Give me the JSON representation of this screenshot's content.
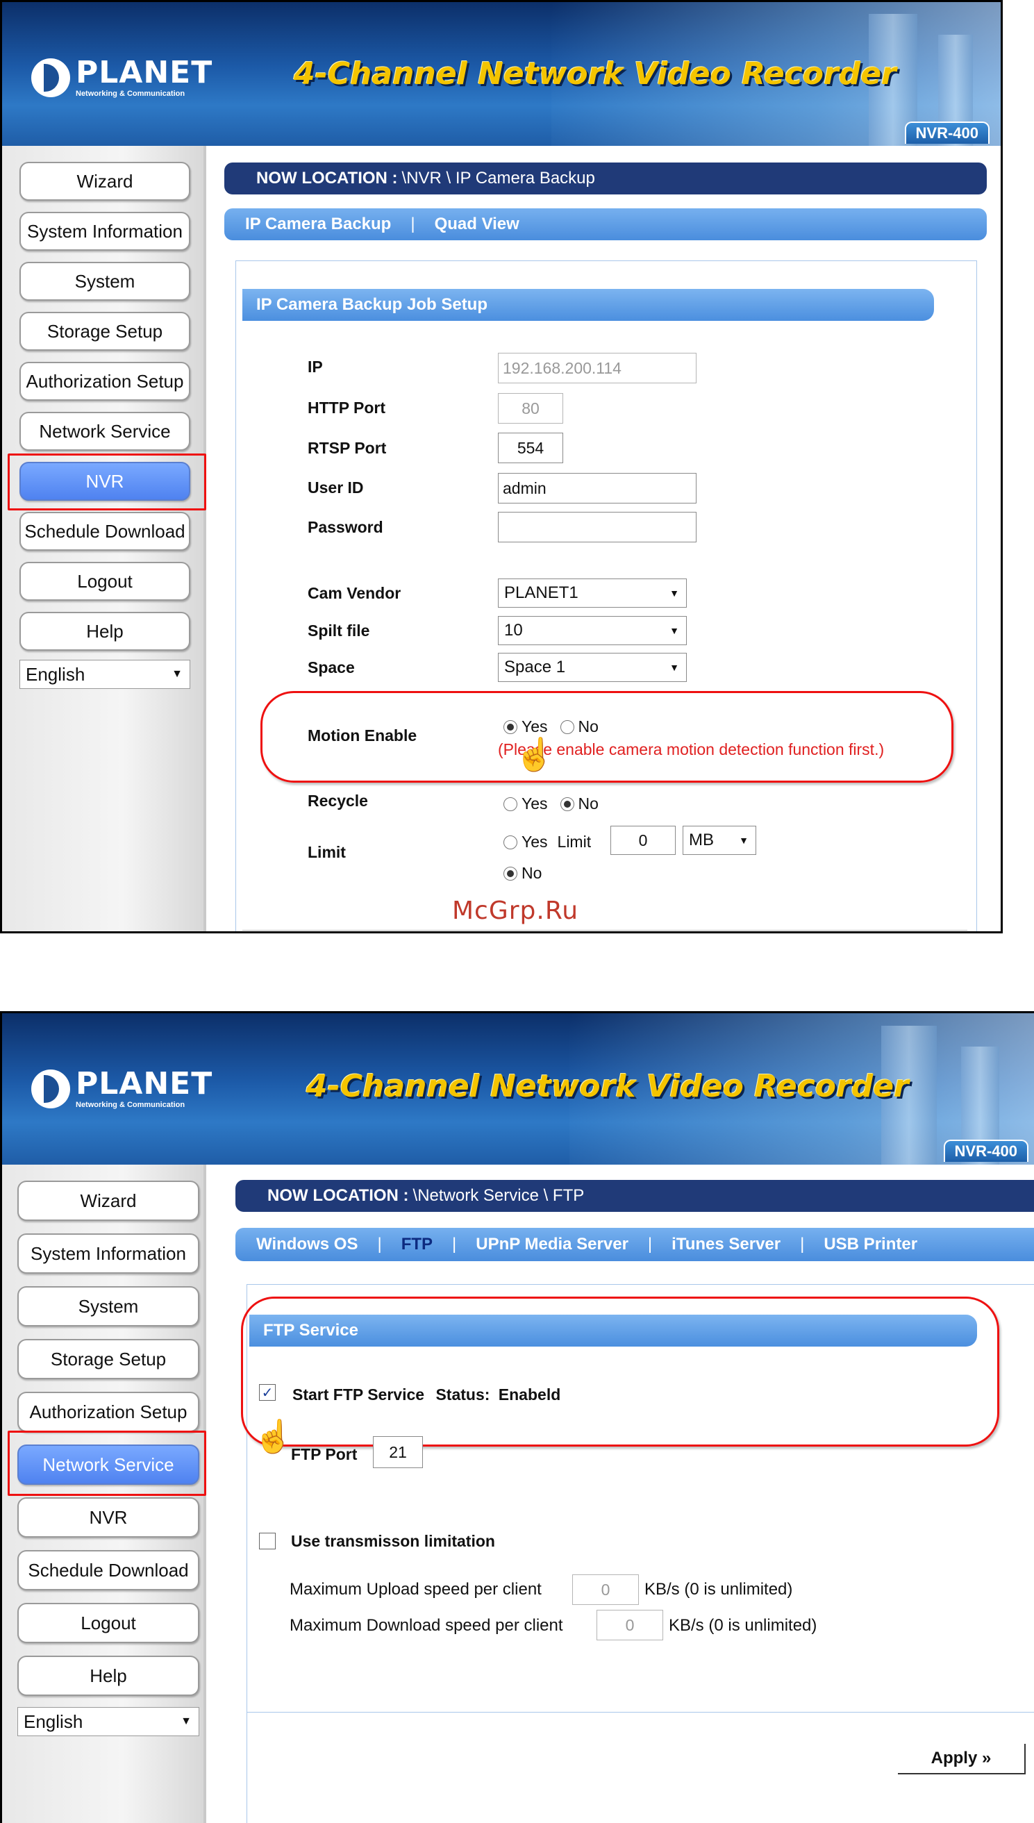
{
  "watermark": "McGrp.Ru",
  "header": {
    "logo_name": "PLANET",
    "logo_sub": "Networking & Communication",
    "title": "4-Channel Network Video Recorder",
    "model": "NVR-400"
  },
  "panel1": {
    "nav": [
      "Wizard",
      "System Information",
      "System",
      "Storage Setup",
      "Authorization Setup",
      "Network Service",
      "NVR",
      "Schedule Download",
      "Logout",
      "Help"
    ],
    "language": "English",
    "location_label": "NOW LOCATION :",
    "location_path": "\\NVR \\ IP Camera Backup",
    "tabs": [
      "IP Camera Backup",
      "Quad View"
    ],
    "tab_separator": "|",
    "section_title": "IP Camera Backup Job Setup",
    "fields": {
      "ip_label": "IP",
      "ip_value": "192.168.200.114",
      "http_label": "HTTP Port",
      "http_value": "80",
      "rtsp_label": "RTSP Port",
      "rtsp_value": "554",
      "user_label": "User ID",
      "user_value": "admin",
      "password_label": "Password",
      "password_value": "",
      "vendor_label": "Cam Vendor",
      "vendor_value": "PLANET1",
      "split_label": "Spilt file",
      "split_value": "10",
      "space_label": "Space",
      "space_value": "Space 1",
      "motion_label": "Motion Enable",
      "motion_note": "(Please enable camera motion detection function first.)",
      "recycle_label": "Recycle",
      "limit_label": "Limit",
      "limit_inline": "Limit",
      "limit_value": "0",
      "limit_unit": "MB",
      "yes": "Yes",
      "no": "No"
    }
  },
  "panel2": {
    "nav": [
      "Wizard",
      "System Information",
      "System",
      "Storage Setup",
      "Authorization Setup",
      "Network Service",
      "NVR",
      "Schedule Download",
      "Logout",
      "Help"
    ],
    "language": "English",
    "location_label": "NOW LOCATION :",
    "location_path": "\\Network Service \\ FTP",
    "tabs": [
      "Windows OS",
      "FTP",
      "UPnP Media Server",
      "iTunes Server",
      "USB Printer"
    ],
    "tab_separator": "|",
    "section_title": "FTP Service",
    "start_ftp_label": "Start FTP Service",
    "status_label": "Status:",
    "status_value": "Enabeld",
    "ftp_port_label": "FTP Port",
    "ftp_port_value": "21",
    "transmission_label": "Use transmisson limitation",
    "max_upload_label": "Maximum Upload speed per client",
    "max_upload_value": "0",
    "max_download_label": "Maximum Download speed per client",
    "max_download_value": "0",
    "unit_note": "KB/s (0 is unlimited)",
    "apply_label": "Apply »"
  }
}
